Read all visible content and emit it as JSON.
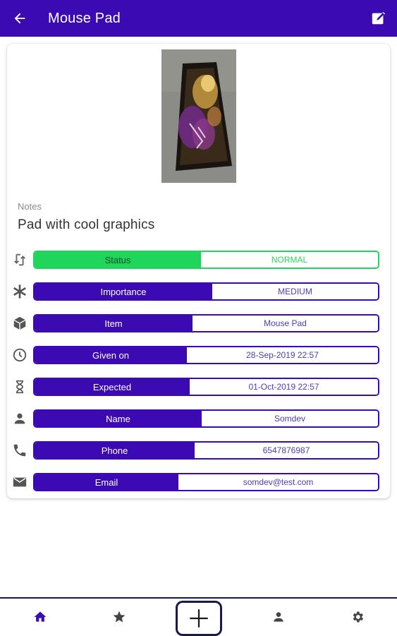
{
  "appbar": {
    "title": "Mouse Pad",
    "back_icon": "arrow-back-icon",
    "edit_icon": "edit-note-icon"
  },
  "notes": {
    "label": "Notes",
    "text": "Pad with cool graphics"
  },
  "fields": [
    {
      "icon": "swap-icon",
      "label": "Status",
      "value": "NORMAL",
      "color": "#1fd65a"
    },
    {
      "icon": "asterisk-icon",
      "label": "Importance",
      "value": "MEDIUM",
      "color": "#3b0ab3"
    },
    {
      "icon": "box-icon",
      "label": "Item",
      "value": "Mouse Pad",
      "color": "#3b0ab3"
    },
    {
      "icon": "clock-icon",
      "label": "Given on",
      "value": "28-Sep-2019 22:57",
      "color": "#3b0ab3"
    },
    {
      "icon": "hourglass-icon",
      "label": "Expected",
      "value": "01-Oct-2019 22:57",
      "color": "#3b0ab3"
    },
    {
      "icon": "person-icon",
      "label": "Name",
      "value": "Somdev",
      "color": "#3b0ab3"
    },
    {
      "icon": "phone-icon",
      "label": "Phone",
      "value": "6547876987",
      "color": "#3b0ab3"
    },
    {
      "icon": "email-icon",
      "label": "Email",
      "value": "somdev@test.com",
      "color": "#3b0ab3"
    }
  ],
  "bottom_nav": [
    "home-icon",
    "star-icon",
    "add-icon",
    "person-icon",
    "settings-icon"
  ],
  "colors": {
    "primary": "#3b0ab3",
    "status_green": "#1fd65a",
    "nav_border": "#1a1a4a"
  }
}
